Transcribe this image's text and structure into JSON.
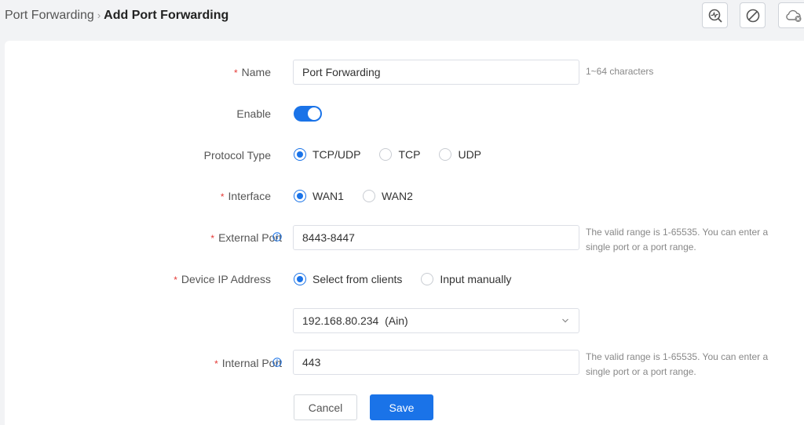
{
  "breadcrumb": {
    "parent": "Port Forwarding",
    "separator": "›",
    "current": "Add Port Forwarding"
  },
  "toolbar_icons": [
    "search-activity-icon",
    "no-entry-icon",
    "cloud-disabled-icon"
  ],
  "colors": {
    "accent": "#1a73e8",
    "required": "#e53935"
  },
  "form": {
    "name": {
      "label": "Name",
      "required_mark": "*",
      "value": "Port Forwarding",
      "hint": "1~64 characters"
    },
    "enable": {
      "label": "Enable",
      "on": true
    },
    "protocol_type": {
      "label": "Protocol Type",
      "options": [
        "TCP/UDP",
        "TCP",
        "UDP"
      ],
      "selected": "TCP/UDP"
    },
    "interface": {
      "label": "Interface",
      "required_mark": "*",
      "options": [
        "WAN1",
        "WAN2"
      ],
      "selected": "WAN1"
    },
    "external_port": {
      "label": "External Port",
      "required_mark": "*",
      "value": "8443-8447",
      "hint_line1": "The valid range is 1-65535. You can enter a",
      "hint_line2": "single port or a port range."
    },
    "device_ip": {
      "label": "Device IP Address",
      "required_mark": "*",
      "options": [
        "Select from clients",
        "Input manually"
      ],
      "selected": "Select from clients",
      "select_value": "192.168.80.234  (Ain)"
    },
    "internal_port": {
      "label": "Internal Port",
      "required_mark": "*",
      "value": "443",
      "hint_line1": "The valid range is 1-65535. You can enter a",
      "hint_line2": "single port or a port range."
    }
  },
  "buttons": {
    "cancel": "Cancel",
    "save": "Save"
  }
}
